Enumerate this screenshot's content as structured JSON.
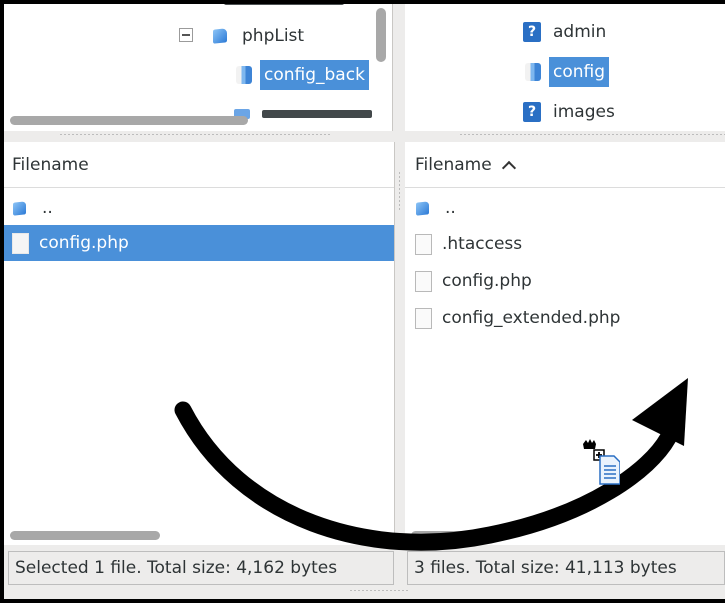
{
  "local_tree": {
    "items": [
      {
        "label": "phpList",
        "icon": "folder-icon",
        "expanded": true
      },
      {
        "label": "config_back",
        "icon": "folder-open-icon",
        "selected": true
      }
    ]
  },
  "remote_tree": {
    "items": [
      {
        "label": "admin",
        "icon": "question-icon"
      },
      {
        "label": "config",
        "icon": "folder-open-icon",
        "selected": true
      },
      {
        "label": "images",
        "icon": "question-icon"
      }
    ]
  },
  "local_list": {
    "header": "Filename",
    "rows": [
      {
        "name": "..",
        "icon": "parent-folder-icon"
      },
      {
        "name": "config.php",
        "icon": "file-icon",
        "selected": true
      }
    ]
  },
  "remote_list": {
    "header": "Filename",
    "sort_indicator": "^",
    "rows": [
      {
        "name": "..",
        "icon": "parent-folder-icon"
      },
      {
        "name": ".htaccess",
        "icon": "file-icon"
      },
      {
        "name": "config.php",
        "icon": "file-icon"
      },
      {
        "name": "config_extended.php",
        "icon": "file-icon"
      }
    ]
  },
  "status": {
    "local": "Selected 1 file. Total size: 4,162 bytes",
    "remote": "3 files. Total size: 41,113 bytes"
  },
  "colors": {
    "selection": "#4a90d9",
    "folder": "#2c7ad6",
    "arrow": "#000000"
  }
}
